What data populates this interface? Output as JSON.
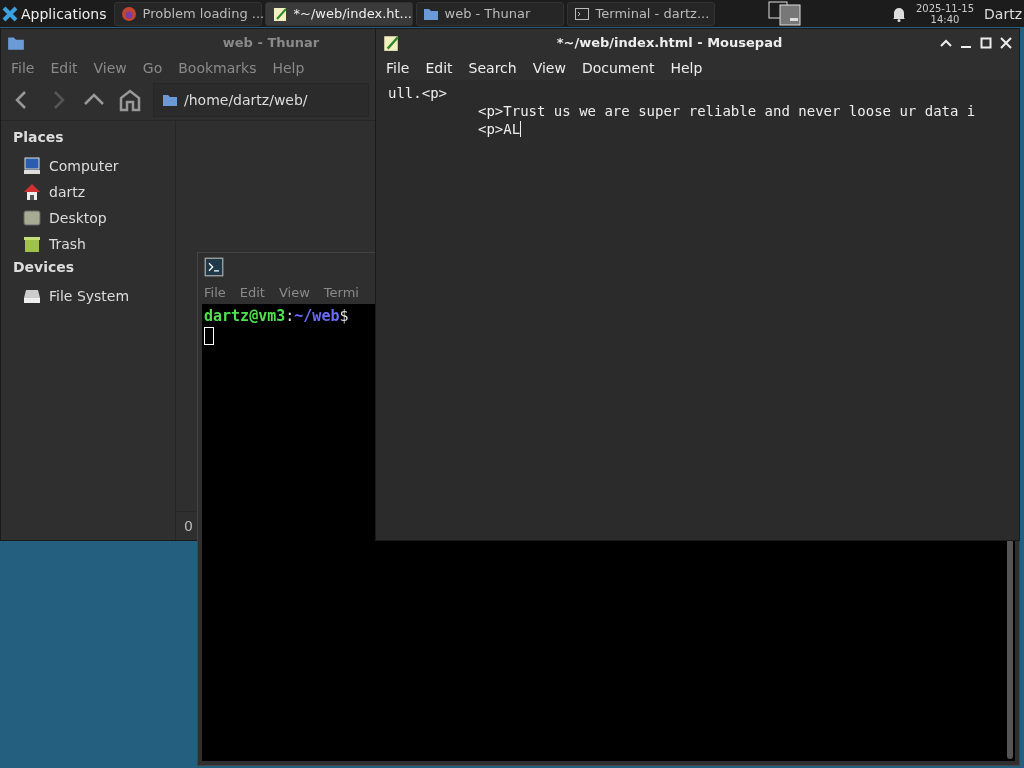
{
  "taskbar": {
    "apps_menu": "Applications",
    "tasks": [
      {
        "label": "Problem loading ...",
        "kind": "browser",
        "selected": false
      },
      {
        "label": "*~/web/index.ht...",
        "kind": "editor",
        "selected": true
      },
      {
        "label": "web - Thunar",
        "kind": "folder",
        "selected": false
      },
      {
        "label": "Terminal - dartz...",
        "kind": "terminal",
        "selected": false
      }
    ],
    "date": "2025-11-15",
    "time": "14:40",
    "user": "Dartz"
  },
  "file_manager": {
    "title": "web - Thunar",
    "menu": [
      "File",
      "Edit",
      "View",
      "Go",
      "Bookmarks",
      "Help"
    ],
    "path": "/home/dartz/web/",
    "sections": [
      {
        "title": "Places",
        "items": [
          {
            "label": "Computer",
            "kind": "computer"
          },
          {
            "label": "dartz",
            "kind": "home"
          },
          {
            "label": "Desktop",
            "kind": "desktop"
          },
          {
            "label": "Trash",
            "kind": "trash"
          }
        ]
      },
      {
        "title": "Devices",
        "items": [
          {
            "label": "File System",
            "kind": "drive"
          }
        ]
      }
    ],
    "status": "0"
  },
  "terminal": {
    "menu": [
      "File",
      "Edit",
      "View",
      "Termi"
    ],
    "prompt_user": "dartz@vm3",
    "prompt_separator": ":",
    "prompt_path": "~/web",
    "prompt_sign": "$"
  },
  "editor": {
    "title": "*~/web/index.html - Mousepad",
    "menu": [
      "File",
      "Edit",
      "Search",
      "View",
      "Document",
      "Help"
    ],
    "lines": [
      {
        "text": "ull.<p>",
        "indented": false
      },
      {
        "text": "<p>Trust us we are super reliable and never loose ur data i",
        "indented": true
      },
      {
        "text": "<p>AL",
        "indented": true
      }
    ]
  }
}
